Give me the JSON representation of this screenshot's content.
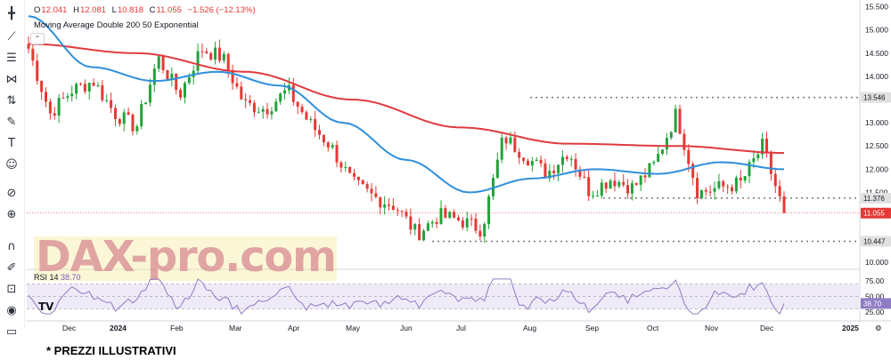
{
  "header": {
    "open_label": "O",
    "open": "12.041",
    "high_label": "H",
    "high": "12.081",
    "low_label": "L",
    "low": "10.818",
    "close_label": "C",
    "close": "11.055",
    "change": "−1.526 (−12.13%)"
  },
  "indicator": {
    "ma_label": "Moving Average Double 200 50 Exponential",
    "rsi_name": "RSI 14",
    "rsi_value": "38.70"
  },
  "watermark": "DAX-pro.com",
  "tv_logo": "TV",
  "footer_note": "* PREZZI ILLUSTRATIVI",
  "colors": {
    "up": "#22a23a",
    "down": "#e53935",
    "ema200": "#e03a3e",
    "ema50": "#2f8fdc",
    "rsi": "#8e7cc3",
    "rsi_band": "#efeaf8",
    "level_dots": "#777777",
    "watermark": "#d88a92",
    "watermark_band": "#f3e98a"
  },
  "toolbar_icons": [
    "crosshair-icon",
    "trend-line-icon",
    "fib-retracement-icon",
    "pattern-icon",
    "prediction-icon",
    "brush-icon",
    "text-icon",
    "emoji-icon",
    "ruler-icon",
    "zoom-in-icon",
    "magnet-icon",
    "lock-drawing-icon",
    "lock-icon",
    "eye-icon",
    "trash-icon"
  ],
  "chart_data": {
    "type": "candlestick",
    "x_ticks": [
      "Dec",
      "2024",
      "Feb",
      "Mar",
      "Apr",
      "May",
      "Jun",
      "Jul",
      "Aug",
      "Sep",
      "Oct",
      "Nov",
      "Dec",
      "2025"
    ],
    "y_ticks": [
      "15.500",
      "15.000",
      "14.500",
      "14.000",
      "13.500",
      "13.000",
      "12.500",
      "12.000",
      "11.500",
      "11.000",
      "10.500",
      "10.000"
    ],
    "ylim": [
      9.9,
      15.55
    ],
    "price_badges": [
      {
        "value": "13.546",
        "color": "#e0e0e0",
        "text": "#131722"
      },
      {
        "value": "11.376",
        "color": "#e0e0e0",
        "text": "#131722"
      },
      {
        "value": "11.055",
        "color": "#e53935",
        "text": "#ffffff"
      },
      {
        "value": "10.447",
        "color": "#e0e0e0",
        "text": "#131722"
      }
    ],
    "levels": [
      {
        "price": 13.546,
        "from": "Aug",
        "to": "axis"
      },
      {
        "price": 11.376,
        "from": "Sep",
        "to": "axis"
      },
      {
        "price": 10.447,
        "from": "Jun",
        "to": "axis"
      }
    ],
    "last_price": 11.055,
    "close_anchors": [
      [
        "Nov 2023",
        14.6
      ],
      [
        "Dec",
        13.2
      ],
      [
        "mid Dec",
        13.7
      ],
      [
        "2024",
        13.9
      ],
      [
        "mid Jan",
        13.2
      ],
      [
        "late Jan",
        12.9
      ],
      [
        "Feb",
        14.4
      ],
      [
        "mid Feb",
        13.6
      ],
      [
        "late Feb",
        14.6
      ],
      [
        "Mar",
        14.4
      ],
      [
        "mid Mar",
        13.4
      ],
      [
        "late Mar",
        13.3
      ],
      [
        "Apr",
        13.7
      ],
      [
        "mid Apr",
        13.0
      ],
      [
        "late Apr",
        12.5
      ],
      [
        "May",
        11.7
      ],
      [
        "mid May",
        11.4
      ],
      [
        "late May",
        11.2
      ],
      [
        "Jun",
        10.6
      ],
      [
        "mid Jun",
        11.0
      ],
      [
        "late Jun",
        10.9
      ],
      [
        "Jul",
        10.7
      ],
      [
        "mid Jul",
        12.7
      ],
      [
        "late Jul",
        12.3
      ],
      [
        "Aug",
        11.9
      ],
      [
        "mid Aug",
        12.4
      ],
      [
        "Sep",
        11.5
      ],
      [
        "mid Sep",
        11.8
      ],
      [
        "Oct",
        11.6
      ],
      [
        "mid Oct",
        12.1
      ],
      [
        "late Oct",
        13.2
      ],
      [
        "Nov",
        11.5
      ],
      [
        "mid Nov",
        11.6
      ],
      [
        "late Nov",
        11.7
      ],
      [
        "Dec",
        12.5
      ],
      [
        "Dec 5",
        11.055
      ]
    ],
    "ema200_anchors": [
      [
        "Dec 2023",
        14.7
      ],
      [
        "Feb",
        14.5
      ],
      [
        "Apr",
        14.1
      ],
      [
        "Jun",
        13.5
      ],
      [
        "Aug",
        12.9
      ],
      [
        "Oct",
        12.55
      ],
      [
        "Nov",
        12.5
      ],
      [
        "Dec",
        12.35
      ]
    ],
    "ema50_anchors": [
      [
        "Nov 2023",
        15.3
      ],
      [
        "Jan",
        14.2
      ],
      [
        "Feb",
        13.9
      ],
      [
        "Mar",
        14.1
      ],
      [
        "Apr",
        13.8
      ],
      [
        "May",
        13.0
      ],
      [
        "Jun",
        12.2
      ],
      [
        "Jul",
        11.5
      ],
      [
        "Aug",
        11.8
      ],
      [
        "Sep",
        12.0
      ],
      [
        "Oct",
        11.9
      ],
      [
        "Nov",
        12.15
      ],
      [
        "Dec",
        12.0
      ]
    ],
    "rsi": {
      "levels": [
        70,
        50,
        30
      ],
      "ticks": [
        "75.00",
        "50.00",
        "25.00"
      ],
      "value": 38.7
    }
  }
}
